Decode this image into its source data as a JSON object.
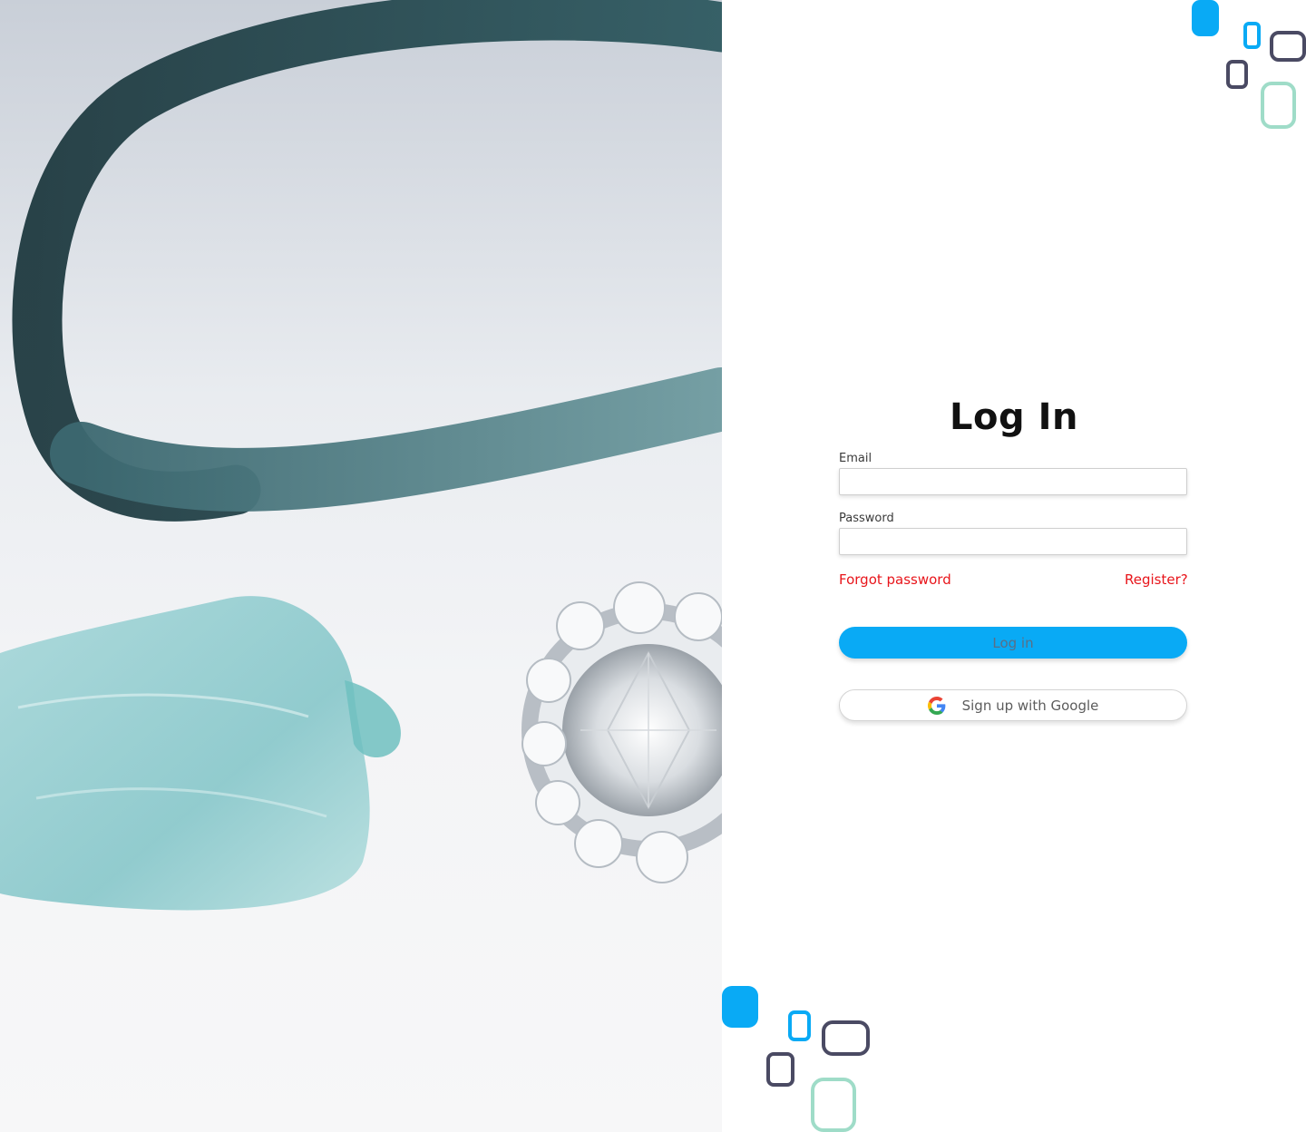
{
  "hero": {
    "image_subject": "jewelry-photo-ribbon-sea-glass-diamond-ring"
  },
  "login": {
    "title": "Log In",
    "email_label": "Email",
    "email_value": "",
    "password_label": "Password",
    "password_value": "",
    "forgot_password": "Forgot password",
    "register": "Register?",
    "login_button": "Log in",
    "google_button": "Sign up with Google"
  },
  "icons": {
    "google": "google-g-icon",
    "decoration": "rounded-squares-decoration"
  },
  "colors": {
    "accent_blue": "#09aaf5",
    "link_red": "#e8151b",
    "deco_dark": "#4a4a63",
    "deco_mint": "#9fdcc8",
    "deco_blue": "#09aaf5"
  }
}
